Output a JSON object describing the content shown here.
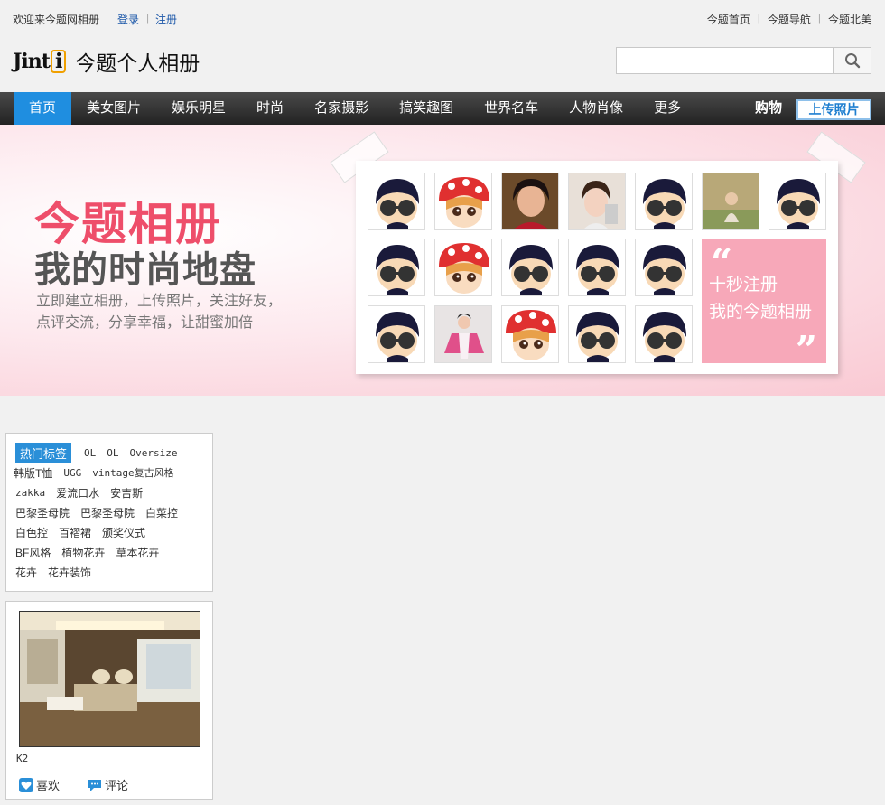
{
  "topbar": {
    "welcome": "欢迎来今题网相册",
    "login": "登录",
    "divider": "|",
    "register": "注册",
    "right_links": [
      "今题首页",
      "今题导航",
      "今题北美"
    ]
  },
  "header": {
    "logo_mark": "Jint",
    "logo_mark_badge": "i",
    "logo_text": "今题个人相册",
    "search_placeholder": "",
    "search_icon": "search-icon"
  },
  "nav": {
    "items": [
      {
        "label": "首页",
        "active": true
      },
      {
        "label": "美女图片"
      },
      {
        "label": "娱乐明星"
      },
      {
        "label": "时尚"
      },
      {
        "label": "名家摄影"
      },
      {
        "label": "搞笑趣图"
      },
      {
        "label": "世界名车"
      },
      {
        "label": "人物肖像"
      },
      {
        "label": "更多"
      }
    ],
    "shop": "购物",
    "upload": "上传照片"
  },
  "banner": {
    "title1": "今题相册",
    "title2": "我的时尚地盘",
    "desc_line1": "立即建立相册，上传照片，关注好友，",
    "desc_line2": "点评交流，分享幸福，让甜蜜加倍",
    "register_box": {
      "quote_open": "“",
      "line1": "十秒注册",
      "line2": "我的今题相册",
      "quote_close": "”"
    },
    "accent_color": "#ee4e6a",
    "register_color": "#f7a8b9"
  },
  "tags": {
    "hot_label": "热门标签",
    "lines": [
      [
        "OL",
        "OL",
        "Oversize"
      ],
      [
        "韩版T恤",
        "UGG",
        "vintage复古风格"
      ],
      [
        "zakka",
        "爱流口水",
        "安吉斯"
      ],
      [
        "巴黎圣母院",
        "巴黎圣母院",
        "白菜控"
      ],
      [
        "白色控",
        "百褶裙",
        "颁奖仪式"
      ],
      [
        "BF风格",
        "植物花卉",
        "草本花卉"
      ],
      [
        "花卉",
        "花卉装饰"
      ]
    ]
  },
  "card": {
    "caption": "K2",
    "like": "喜欢",
    "comment": "评论",
    "like_icon": "heart-icon",
    "comment_icon": "comment-icon"
  },
  "colors": {
    "nav_active": "#1f8ee0",
    "link": "#1a56a8"
  }
}
